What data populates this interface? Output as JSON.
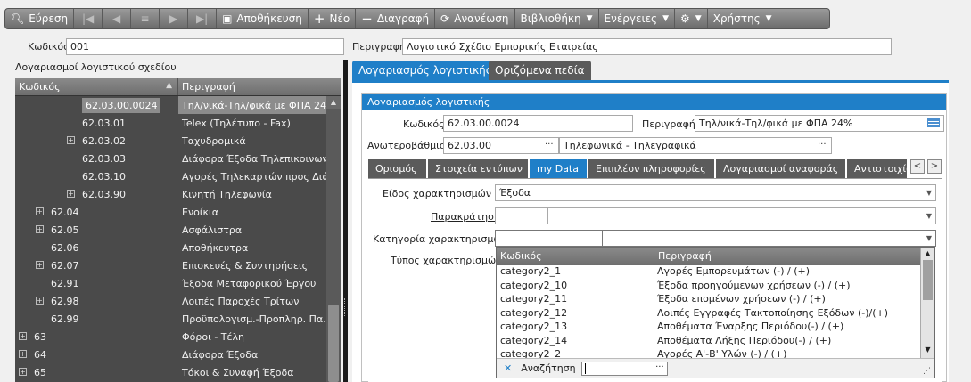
{
  "toolbar": {
    "search": "Εύρεση",
    "save": "Αποθήκευση",
    "new": "Νέο",
    "delete": "Διαγραφή",
    "refresh": "Ανανέωση",
    "library": "Βιβλιοθήκη",
    "actions": "Ενέργειες",
    "users": "Χρήστης"
  },
  "header": {
    "code_label": "Κωδικός",
    "code_value": "001",
    "desc_label": "Περιγραφή",
    "desc_value": "Λογιστικό Σχέδιο Εμπορικής Εταιρείας"
  },
  "left": {
    "title": "Λογαριασμοί λογιστικού σχεδίου",
    "col_code": "Κωδικός",
    "col_desc": "Περιγραφή",
    "rows": [
      {
        "code": "62.03.00.0024",
        "desc": "Τηλ/νικά-Τηλ/φικά με ΦΠΑ 24%"
      },
      {
        "code": "62.03.01",
        "desc": "Telex (Τηλέτυπο - Fax)"
      },
      {
        "code": "62.03.02",
        "desc": "Ταχυδρομικά"
      },
      {
        "code": "62.03.03",
        "desc": "Διάφορα Έξοδα Τηλεπικοινων..."
      },
      {
        "code": "62.03.10",
        "desc": "Αγορές Τηλεκαρτών προς Διά..."
      },
      {
        "code": "62.03.90",
        "desc": "Κινητή Τηλεφωνία"
      },
      {
        "code": "62.04",
        "desc": "Ενοίκια"
      },
      {
        "code": "62.05",
        "desc": "Ασφάλιστρα"
      },
      {
        "code": "62.06",
        "desc": "Αποθήκευτρα"
      },
      {
        "code": "62.07",
        "desc": "Επισκευές & Συντηρήσεις"
      },
      {
        "code": "62.91",
        "desc": "Έξοδα Μεταφορικού Έργου"
      },
      {
        "code": "62.98",
        "desc": "Λοιπές Παροχές Τρίτων"
      },
      {
        "code": "62.99",
        "desc": "Προϋπολογισμ.-Προπληρ. Πα..."
      },
      {
        "code": "63",
        "desc": "Φόροι - Τέλη"
      },
      {
        "code": "64",
        "desc": "Διάφορα Έξοδα"
      },
      {
        "code": "65",
        "desc": "Τόκοι & Συναφή Έξοδα"
      }
    ]
  },
  "tabs": {
    "account": "Λογαριασμός λογιστικής",
    "custom": "Οριζόμενα πεδία"
  },
  "account": {
    "group_title": "Λογαριασμός λογιστικής",
    "code_label": "Κωδικός",
    "code_value": "62.03.00.0024",
    "desc_label": "Περιγραφή",
    "desc_value": "Τηλ/νικά-Τηλ/φικά με ΦΠΑ 24%",
    "parent_label": "Ανωτεροβάθμιος",
    "parent_code": "62.03.00",
    "parent_desc": "Τηλεφωνικά - Τηλεγραφικά"
  },
  "subtabs": [
    "Ορισμός",
    "Στοιχεία εντύπων",
    "my Data",
    "Επιπλέον πληροφορίες",
    "Λογαριασμοί αναφοράς",
    "Αντιστοιχίσεις"
  ],
  "mydata": {
    "type_label": "Είδος χαρακτηρισμών",
    "type_value": "Έξοδα",
    "exception_label": "Παρακράτηση",
    "category_label": "Κατηγορία χαρακτηρισμών",
    "chartype_label": "Τύπος χαρακτηρισμών"
  },
  "popup": {
    "col_code": "Κωδικός",
    "col_desc": "Περιγραφή",
    "rows": [
      {
        "code": "category2_1",
        "desc": "Αγορές Εμπορευμάτων (-) / (+)"
      },
      {
        "code": "category2_10",
        "desc": "Έξοδα προηγούμενων χρήσεων (-) / (+)"
      },
      {
        "code": "category2_11",
        "desc": "Έξοδα επομένων χρήσεων (-) / (+)"
      },
      {
        "code": "category2_12",
        "desc": "Λοιπές Εγγραφές Τακτοποίησης Εξόδων (-)/(+)"
      },
      {
        "code": "category2_13",
        "desc": "Αποθέματα Έναρξης Περιόδου(-) / (+)"
      },
      {
        "code": "category2_14",
        "desc": "Αποθέματα Λήξης Περιόδου(-) / (+)"
      },
      {
        "code": "category2_2",
        "desc": "Αγορές Α'-Β' Υλών (-) / (+)"
      }
    ],
    "search_label": "Αναζήτηση"
  }
}
